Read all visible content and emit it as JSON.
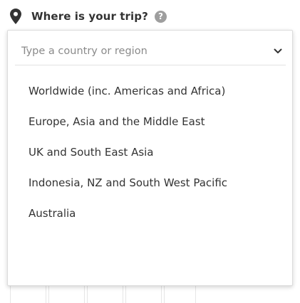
{
  "header": {
    "title": "Where is your trip?",
    "help_glyph": "?",
    "location_icon": "map-pin-icon"
  },
  "dropdown": {
    "search_placeholder": "Type a country or region",
    "search_value": "",
    "toggle_icon": "chevron-down-icon",
    "options": [
      {
        "label": "Worldwide (inc. Americas and Africa)"
      },
      {
        "label": "Europe, Asia and the Middle East"
      },
      {
        "label": "UK and South East Asia"
      },
      {
        "label": "Indonesia, NZ and South West Pacific"
      },
      {
        "label": "Australia"
      }
    ]
  },
  "colors": {
    "text": "#333333",
    "placeholder": "#8a8a8a",
    "help_badge": "#9e9e9e",
    "border": "#dcdcdc"
  }
}
